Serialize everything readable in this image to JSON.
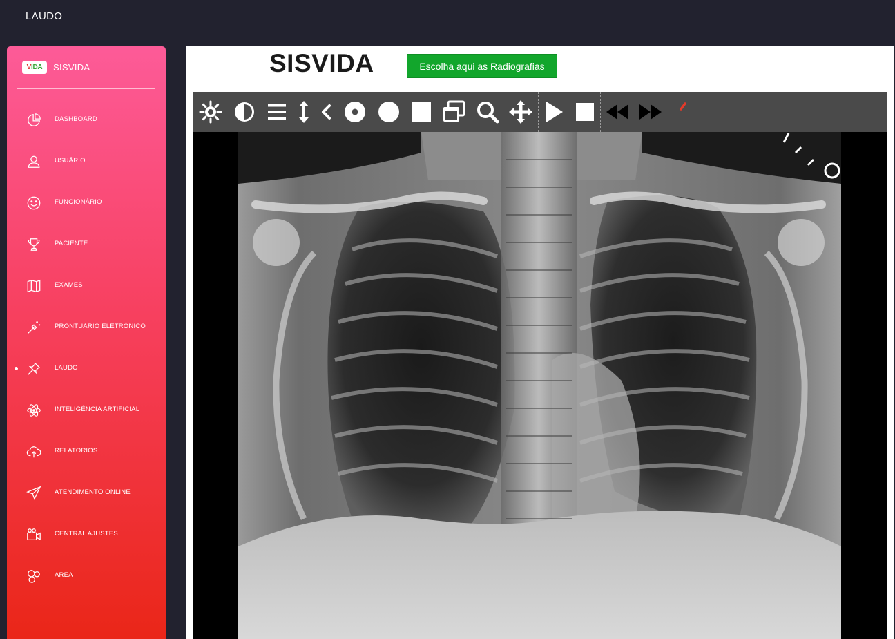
{
  "topbar": {
    "title": "LAUDO"
  },
  "brand": {
    "logo_text": "VIDA",
    "name": "SISVIDA"
  },
  "sidebar": {
    "items": [
      {
        "label": "DASHBOARD",
        "icon": "pie-chart-icon"
      },
      {
        "label": "USUÁRIO",
        "icon": "user-icon"
      },
      {
        "label": "FUNCIONÁRIO",
        "icon": "smiley-icon"
      },
      {
        "label": "PACIENTE",
        "icon": "trophy-icon"
      },
      {
        "label": "EXAMES",
        "icon": "map-icon"
      },
      {
        "label": "PRONTUÁRIO ELETRÔNICO",
        "icon": "magic-wand-icon"
      },
      {
        "label": "LAUDO",
        "icon": "pin-icon",
        "active": true
      },
      {
        "label": "INTELIGÊNCIA ARTIFICIAL",
        "icon": "atom-icon"
      },
      {
        "label": "RELATORIOS",
        "icon": "cloud-upload-icon"
      },
      {
        "label": "ATENDIMENTO ONLINE",
        "icon": "paper-plane-icon"
      },
      {
        "label": "CENTRAL AJUSTES",
        "icon": "video-camera-icon"
      },
      {
        "label": "AREA",
        "icon": "circles-icon"
      }
    ]
  },
  "main": {
    "title": "SISVIDA",
    "choose_button": "Escolha aqui as Radiografias",
    "toolbar": [
      "brightness-icon",
      "contrast-icon",
      "menu-lines-icon",
      "vertical-resize-icon",
      "chevron-left-icon",
      "ring-icon",
      "circle-icon",
      "square-icon",
      "layers-icon",
      "magnifier-icon",
      "move-icon",
      "play-icon",
      "stop-icon",
      "rewind-icon",
      "fast-forward-icon",
      "red-mark-icon"
    ]
  },
  "colors": {
    "topbar_bg": "#22222f",
    "sidebar_gradient_top": "#fd5b98",
    "sidebar_gradient_bottom": "#ea2618",
    "button_green": "#12a62c",
    "toolbar_bg": "#4a4a4a"
  }
}
